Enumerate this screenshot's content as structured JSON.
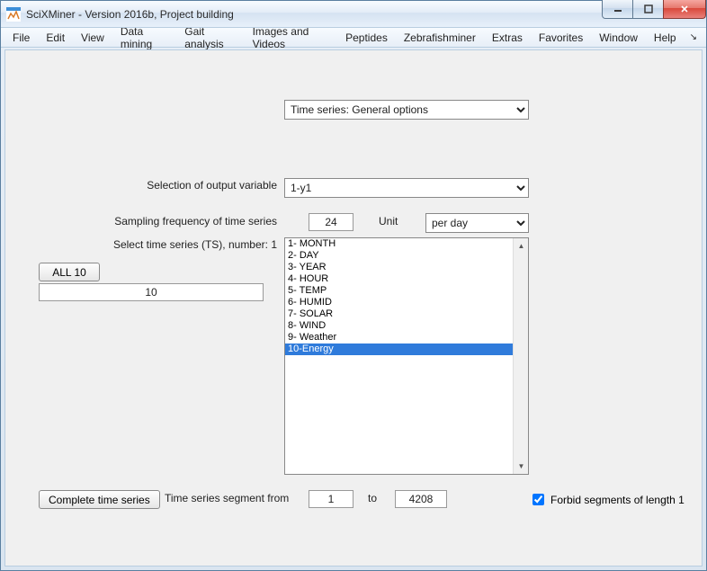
{
  "window": {
    "title": "SciXMiner - Version 2016b, Project building"
  },
  "menu": {
    "items": [
      "File",
      "Edit",
      "View",
      "Data mining",
      "Gait analysis",
      "Images and Videos",
      "Peptides",
      "Zebrafishminer",
      "Extras",
      "Favorites",
      "Window",
      "Help"
    ]
  },
  "general_options": {
    "selected": "Time series: General options"
  },
  "output_variable": {
    "label": "Selection of output variable",
    "selected": "1-y1"
  },
  "sampling": {
    "label": "Sampling frequency of time series",
    "value": "24",
    "unit_label": "Unit",
    "unit_selected": "per day"
  },
  "select_ts": {
    "label": "Select time series (TS), number: 1",
    "all_button": "ALL 10",
    "count_value": "10",
    "items": [
      "1- MONTH",
      "2- DAY",
      "3- YEAR",
      "4- HOUR",
      "5- TEMP",
      "6- HUMID",
      "7- SOLAR",
      "8- WIND",
      "9- Weather",
      "10-Energy"
    ],
    "selected_index": 9
  },
  "segment": {
    "complete_button": "Complete time series",
    "label": "Time series segment from",
    "from": "1",
    "to_label": "to",
    "to": "4208",
    "forbid_label": "Forbid segments of length 1",
    "forbid_checked": true
  }
}
